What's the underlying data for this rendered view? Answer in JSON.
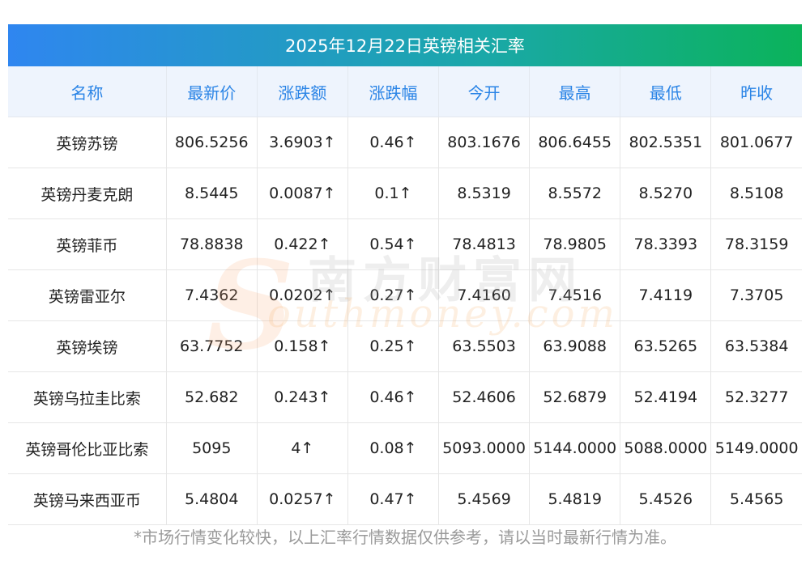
{
  "title": "2025年12月22日英镑相关汇率",
  "columns": [
    "名称",
    "最新价",
    "涨跌额",
    "涨跌幅",
    "今开",
    "最高",
    "最低",
    "昨收"
  ],
  "rows": [
    {
      "name": "英镑苏镑",
      "latest": "806.5256",
      "change": "3.6903↑",
      "change_pct": "0.46↑",
      "open": "803.1676",
      "high": "806.6455",
      "low": "802.5351",
      "prev_close": "801.0677"
    },
    {
      "name": "英镑丹麦克朗",
      "latest": "8.5445",
      "change": "0.0087↑",
      "change_pct": "0.1↑",
      "open": "8.5319",
      "high": "8.5572",
      "low": "8.5270",
      "prev_close": "8.5108"
    },
    {
      "name": "英镑菲币",
      "latest": "78.8838",
      "change": "0.422↑",
      "change_pct": "0.54↑",
      "open": "78.4813",
      "high": "78.9805",
      "low": "78.3393",
      "prev_close": "78.3159"
    },
    {
      "name": "英镑雷亚尔",
      "latest": "7.4362",
      "change": "0.0202↑",
      "change_pct": "0.27↑",
      "open": "7.4160",
      "high": "7.4516",
      "low": "7.4119",
      "prev_close": "7.3705"
    },
    {
      "name": "英镑埃镑",
      "latest": "63.7752",
      "change": "0.158↑",
      "change_pct": "0.25↑",
      "open": "63.5503",
      "high": "63.9088",
      "low": "63.5265",
      "prev_close": "63.5384"
    },
    {
      "name": "英镑乌拉圭比索",
      "latest": "52.682",
      "change": "0.243↑",
      "change_pct": "0.46↑",
      "open": "52.4606",
      "high": "52.6879",
      "low": "52.4194",
      "prev_close": "52.3277"
    },
    {
      "name": "英镑哥伦比亚比索",
      "latest": "5095",
      "change": "4↑",
      "change_pct": "0.08↑",
      "open": "5093.0000",
      "high": "5144.0000",
      "low": "5088.0000",
      "prev_close": "5149.0000"
    },
    {
      "name": "英镑马来西亚币",
      "latest": "5.4804",
      "change": "0.0257↑",
      "change_pct": "0.47↑",
      "open": "5.4569",
      "high": "5.4819",
      "low": "5.4526",
      "prev_close": "5.4565"
    }
  ],
  "footer": "*市场行情变化较快，以上汇率行情数据仅供参考，请以当时最新行情为准。",
  "watermark": {
    "letter": "S",
    "cn": "南方财富网",
    "en": "outhmoney.com"
  },
  "colors": {
    "header_start": "#2f86f0",
    "header_end": "#0bb35a",
    "header_text": "#2a84e6",
    "up": "#e8242b",
    "text": "#222222"
  }
}
